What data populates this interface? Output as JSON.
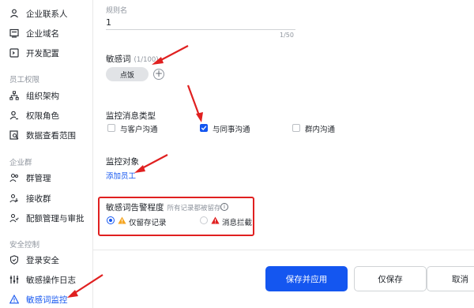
{
  "sidebar": {
    "items_top": [
      {
        "label": "企业联系人",
        "icon": "person-icon"
      },
      {
        "label": "企业域名",
        "icon": "domain-icon"
      },
      {
        "label": "开发配置",
        "icon": "dev-config-icon"
      }
    ],
    "group_staff": "员工权限",
    "items_staff": [
      {
        "label": "组织架构",
        "icon": "org-chart-icon"
      },
      {
        "label": "权限角色",
        "icon": "role-icon"
      },
      {
        "label": "数据查看范围",
        "icon": "data-scope-icon"
      }
    ],
    "group_corp": "企业群",
    "items_corp": [
      {
        "label": "群管理",
        "icon": "group-manage-icon"
      },
      {
        "label": "接收群",
        "icon": "receive-group-icon"
      },
      {
        "label": "配额管理与审批",
        "icon": "quota-icon"
      }
    ],
    "group_security": "安全控制",
    "items_security": [
      {
        "label": "登录安全",
        "icon": "shield-icon"
      },
      {
        "label": "敏感操作日志",
        "icon": "log-icon"
      },
      {
        "label": "敏感词监控",
        "icon": "warning-icon",
        "active": true
      }
    ]
  },
  "rule_name": {
    "label": "规则名",
    "value": "1",
    "count": "1/50"
  },
  "sensitive_words": {
    "label": "敏感词",
    "count_hint": "(1/100)",
    "chip": "点饭",
    "add_symbol": "+"
  },
  "monitor_type": {
    "label": "监控消息类型",
    "options": [
      {
        "label": "与客户沟通",
        "checked": false
      },
      {
        "label": "与同事沟通",
        "checked": true
      },
      {
        "label": "群内沟通",
        "checked": false
      }
    ]
  },
  "monitor_target": {
    "label": "监控对象",
    "link": "添加员工"
  },
  "alert_level": {
    "label": "敏感词告警程度",
    "hint": "所有记录都被留存",
    "info_symbol": "i",
    "options": [
      {
        "label": "仅留存记录",
        "selected": true,
        "icon_color": "#f5a623"
      },
      {
        "label": "消息拦截",
        "selected": false,
        "icon_color": "#e02020"
      }
    ]
  },
  "footer": {
    "save_apply": "保存并应用",
    "save_only": "仅保存",
    "cancel": "取消"
  },
  "colors": {
    "accent": "#1456f0",
    "annotation_red": "#e02020"
  }
}
